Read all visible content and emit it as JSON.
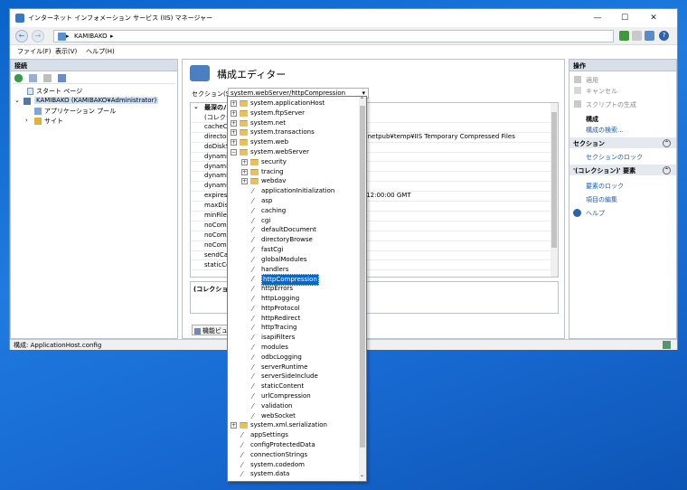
{
  "window": {
    "title": "インターネット インフォメーション サービス (IIS) マネージャー",
    "minimize": "—",
    "maximize": "☐",
    "close": "✕"
  },
  "address": {
    "back": "←",
    "forward": "→",
    "crumb": "KAMIBAKO",
    "arrow": "▸",
    "help": "?"
  },
  "menu": [
    "ファイル(F)",
    "表示(V)",
    "ヘルプ(H)"
  ],
  "left": {
    "title": "接続",
    "tree": [
      {
        "label": "スタート ページ",
        "icon": "start-page-icon"
      },
      {
        "label": "KAMIBAKO (KAMIBAKO¥Administrator)",
        "icon": "server-icon"
      },
      {
        "label": "アプリケーション プール",
        "icon": "app-pool-icon"
      },
      {
        "label": "サイト",
        "icon": "sites-icon"
      }
    ]
  },
  "center": {
    "heading": "構成エディター",
    "section_label": "セクション(S):",
    "section_value": "system.webServer/httpCompression",
    "grid_header": "最深のパ",
    "rows": [
      {
        "k": "(コレクショ",
        "v": "nt=1)"
      },
      {
        "k": "cacheCo",
        "v": "age=86400"
      },
      {
        "k": "director",
        "v": "temDrive%¥inetpub¥temp¥IIS Temporary Compressed Files"
      },
      {
        "k": "doDiskS",
        "v": ""
      },
      {
        "k": "dynamic",
        "v": "S"
      },
      {
        "k": "dynamic",
        "v": ""
      },
      {
        "k": "dynamic",
        "v": ""
      },
      {
        "k": "dynamic",
        "v": "nt=0)"
      },
      {
        "k": "expiresH",
        "v": "01 Jan 1997 12:00:00 GMT"
      },
      {
        "k": "maxDisk",
        "v": ""
      },
      {
        "k": "minFileS",
        "v": ""
      },
      {
        "k": "noComp",
        "v": ""
      },
      {
        "k": "noComp",
        "v": ""
      },
      {
        "k": "noComp",
        "v": ""
      },
      {
        "k": "sendCac",
        "v": ""
      },
      {
        "k": "staticCo",
        "v": ""
      }
    ],
    "desc": "(コレクション",
    "view_tab": "機能ビュー"
  },
  "dropdown": {
    "items": [
      {
        "label": "system.applicationHost",
        "level": 0,
        "type": "folder",
        "exp": "+"
      },
      {
        "label": "system.ftpServer",
        "level": 0,
        "type": "folder",
        "exp": "+"
      },
      {
        "label": "system.net",
        "level": 0,
        "type": "folder",
        "exp": "+"
      },
      {
        "label": "system.transactions",
        "level": 0,
        "type": "folder",
        "exp": "+"
      },
      {
        "label": "system.web",
        "level": 0,
        "type": "folder",
        "exp": "+"
      },
      {
        "label": "system.webServer",
        "level": 0,
        "type": "folder",
        "exp": "−"
      },
      {
        "label": "security",
        "level": 1,
        "type": "folder",
        "exp": "+"
      },
      {
        "label": "tracing",
        "level": 1,
        "type": "folder",
        "exp": "+"
      },
      {
        "label": "webdav",
        "level": 1,
        "type": "folder",
        "exp": "+"
      },
      {
        "label": "applicationInitialization",
        "level": 1,
        "type": "leaf"
      },
      {
        "label": "asp",
        "level": 1,
        "type": "leaf"
      },
      {
        "label": "caching",
        "level": 1,
        "type": "leaf"
      },
      {
        "label": "cgi",
        "level": 1,
        "type": "leaf"
      },
      {
        "label": "defaultDocument",
        "level": 1,
        "type": "leaf"
      },
      {
        "label": "directoryBrowse",
        "level": 1,
        "type": "leaf"
      },
      {
        "label": "fastCgi",
        "level": 1,
        "type": "leaf"
      },
      {
        "label": "globalModules",
        "level": 1,
        "type": "leaf"
      },
      {
        "label": "handlers",
        "level": 1,
        "type": "leaf"
      },
      {
        "label": "httpCompression",
        "level": 1,
        "type": "leaf",
        "selected": true
      },
      {
        "label": "httpErrors",
        "level": 1,
        "type": "leaf"
      },
      {
        "label": "httpLogging",
        "level": 1,
        "type": "leaf"
      },
      {
        "label": "httpProtocol",
        "level": 1,
        "type": "leaf"
      },
      {
        "label": "httpRedirect",
        "level": 1,
        "type": "leaf"
      },
      {
        "label": "httpTracing",
        "level": 1,
        "type": "leaf"
      },
      {
        "label": "isapiFilters",
        "level": 1,
        "type": "leaf"
      },
      {
        "label": "modules",
        "level": 1,
        "type": "leaf"
      },
      {
        "label": "odbcLogging",
        "level": 1,
        "type": "leaf"
      },
      {
        "label": "serverRuntime",
        "level": 1,
        "type": "leaf"
      },
      {
        "label": "serverSideInclude",
        "level": 1,
        "type": "leaf"
      },
      {
        "label": "staticContent",
        "level": 1,
        "type": "leaf"
      },
      {
        "label": "urlCompression",
        "level": 1,
        "type": "leaf"
      },
      {
        "label": "validation",
        "level": 1,
        "type": "leaf"
      },
      {
        "label": "webSocket",
        "level": 1,
        "type": "leaf"
      },
      {
        "label": "system.xml.serialization",
        "level": 0,
        "type": "folder",
        "exp": "+"
      },
      {
        "label": "appSettings",
        "level": 0,
        "type": "leaf"
      },
      {
        "label": "configProtectedData",
        "level": 0,
        "type": "leaf"
      },
      {
        "label": "connectionStrings",
        "level": 0,
        "type": "leaf"
      },
      {
        "label": "system.codedom",
        "level": 0,
        "type": "leaf"
      },
      {
        "label": "system.data",
        "level": 0,
        "type": "leaf"
      }
    ]
  },
  "right": {
    "title": "操作",
    "apply": "適用",
    "cancel": "キャンセル",
    "script": "スクリプトの生成",
    "config_head": "構成",
    "config_search": "構成の検索...",
    "section_head": "セクション",
    "section_lock": "セクションのロック",
    "collection_head": "'(コレクション)' 要素",
    "lock_element": "要素のロック",
    "edit_items": "項目の編集",
    "help": "ヘルプ",
    "collapse": "⌃"
  },
  "status": {
    "text": "構成: ApplicationHost.config"
  }
}
